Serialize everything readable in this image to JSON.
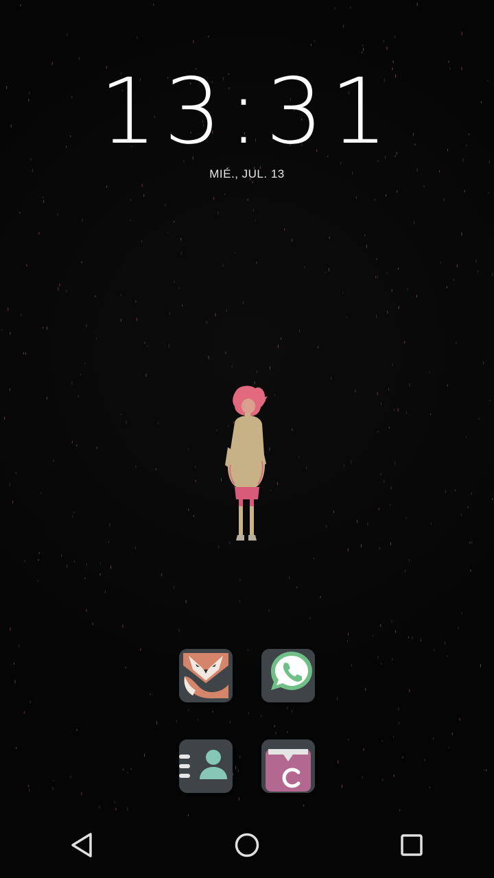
{
  "lockscreen": {
    "clock": {
      "hours": "13",
      "separator": ":",
      "minutes": "31"
    },
    "date": "MIÉ., JUL. 13"
  },
  "wallpaper": {
    "figure_icon": "pink-haired-girl-illustration"
  },
  "apps": [
    {
      "icon": "fox-icon",
      "tile_color": "#3e4448",
      "accent": "#d4856a"
    },
    {
      "icon": "whatsapp-icon",
      "tile_color": "#3e4448",
      "accent": "#6fbf86"
    },
    {
      "icon": "contacts-icon",
      "tile_color": "#3e4448",
      "accent": "#86c7b8"
    },
    {
      "icon": "clipboard-c-icon",
      "tile_color": "#b3698f",
      "accent": "#ffffff"
    }
  ],
  "navigation": {
    "back_icon": "back-triangle-icon",
    "home_icon": "home-circle-icon",
    "recents_icon": "recents-square-icon",
    "icon_color": "#e0e0e0"
  }
}
